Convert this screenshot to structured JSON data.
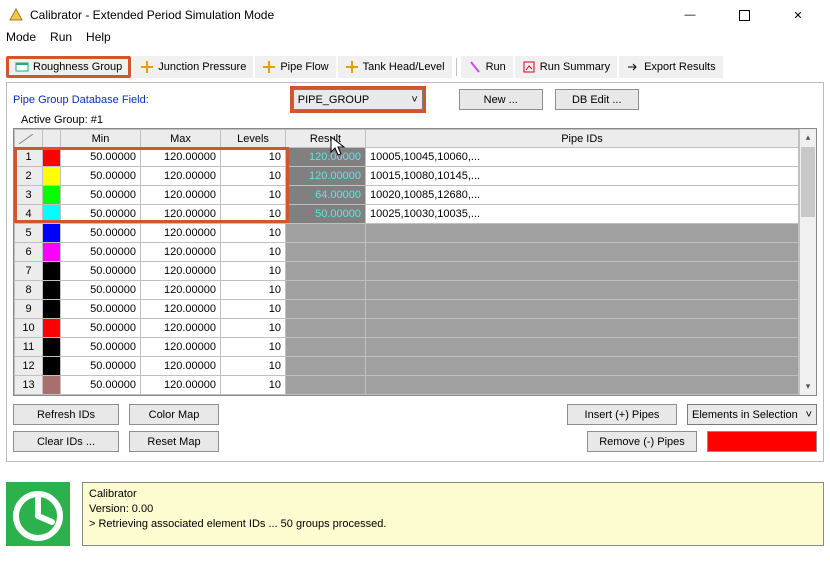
{
  "window": {
    "title": "Calibrator - Extended Period Simulation Mode",
    "minimize": "—",
    "close": "✕"
  },
  "menu": {
    "mode": "Mode",
    "run": "Run",
    "help": "Help"
  },
  "toolbar": {
    "roughness": "Roughness Group",
    "junction": "Junction Pressure",
    "pipeflow": "Pipe Flow",
    "tank": "Tank Head/Level",
    "run": "Run",
    "summary": "Run Summary",
    "export": "Export Results"
  },
  "fields": {
    "pipe_group_label": "Pipe Group Database Field:",
    "pipe_group_value": "PIPE_GROUP",
    "active_group": "Active Group: #1",
    "new_btn": "New ...",
    "dbedit_btn": "DB Edit ..."
  },
  "columns": {
    "min": "Min",
    "max": "Max",
    "levels": "Levels",
    "result": "Result",
    "pipeids": "Pipe IDs"
  },
  "rows": [
    {
      "n": "1",
      "c": "#ff0000",
      "min": "50.00000",
      "max": "120.00000",
      "lev": "10",
      "res": "120.00000",
      "ids": "10005,10045,10060,..."
    },
    {
      "n": "2",
      "c": "#ffff00",
      "min": "50.00000",
      "max": "120.00000",
      "lev": "10",
      "res": "120.00000",
      "ids": "10015,10080,10145,..."
    },
    {
      "n": "3",
      "c": "#00ff00",
      "min": "50.00000",
      "max": "120.00000",
      "lev": "10",
      "res": "64.00000",
      "ids": "10020,10085,12680,..."
    },
    {
      "n": "4",
      "c": "#00ffff",
      "min": "50.00000",
      "max": "120.00000",
      "lev": "10",
      "res": "50.00000",
      "ids": "10025,10030,10035,..."
    },
    {
      "n": "5",
      "c": "#0000ff",
      "min": "50.00000",
      "max": "120.00000",
      "lev": "10",
      "res": "",
      "ids": ""
    },
    {
      "n": "6",
      "c": "#ff00ff",
      "min": "50.00000",
      "max": "120.00000",
      "lev": "10",
      "res": "",
      "ids": ""
    },
    {
      "n": "7",
      "c": "#000000",
      "min": "50.00000",
      "max": "120.00000",
      "lev": "10",
      "res": "",
      "ids": ""
    },
    {
      "n": "8",
      "c": "#000000",
      "min": "50.00000",
      "max": "120.00000",
      "lev": "10",
      "res": "",
      "ids": ""
    },
    {
      "n": "9",
      "c": "#000000",
      "min": "50.00000",
      "max": "120.00000",
      "lev": "10",
      "res": "",
      "ids": ""
    },
    {
      "n": "10",
      "c": "#ff0000",
      "min": "50.00000",
      "max": "120.00000",
      "lev": "10",
      "res": "",
      "ids": ""
    },
    {
      "n": "11",
      "c": "#000000",
      "min": "50.00000",
      "max": "120.00000",
      "lev": "10",
      "res": "",
      "ids": ""
    },
    {
      "n": "12",
      "c": "#000000",
      "min": "50.00000",
      "max": "120.00000",
      "lev": "10",
      "res": "",
      "ids": ""
    },
    {
      "n": "13",
      "c": "#a96f6f",
      "min": "50.00000",
      "max": "120.00000",
      "lev": "10",
      "res": "",
      "ids": ""
    }
  ],
  "buttons": {
    "refresh": "Refresh IDs",
    "colormap": "Color Map",
    "clear": "Clear IDs ...",
    "resetmap": "Reset Map",
    "insert": "Insert (+) Pipes",
    "remove": "Remove (-) Pipes",
    "elements": "Elements in Selection"
  },
  "status": {
    "line1": "Calibrator",
    "line2": "Version: 0.00",
    "line3": "> Retrieving associated element IDs ... 50 groups processed."
  }
}
